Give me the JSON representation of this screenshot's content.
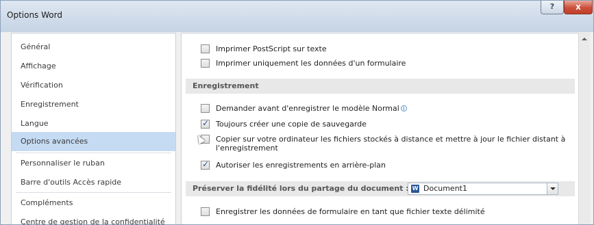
{
  "window": {
    "title": "Options Word",
    "help_symbol": "?",
    "close_symbol": "x"
  },
  "nav": {
    "items": [
      {
        "label": "Général",
        "selected": false
      },
      {
        "label": "Affichage",
        "selected": false
      },
      {
        "label": "Vérification",
        "selected": false
      },
      {
        "label": "Enregistrement",
        "selected": false
      },
      {
        "label": "Langue",
        "selected": false
      },
      {
        "label": "Options avancées",
        "selected": true
      },
      {
        "label": "Personnaliser le ruban",
        "selected": false
      },
      {
        "label": "Barre d'outils Accès rapide",
        "selected": false
      },
      {
        "label": "Compléments",
        "selected": false
      },
      {
        "label": "Centre de gestion de la confidentialité",
        "selected": false
      }
    ]
  },
  "content": {
    "top_options": [
      {
        "label": "Imprimer PostScript sur texte",
        "checked": false
      },
      {
        "label": "Imprimer uniquement les données d'un formulaire",
        "checked": false
      }
    ],
    "section_save": {
      "title": "Enregistrement",
      "options": [
        {
          "label": "Demander avant d'enregistrer le modèle Normal",
          "checked": false,
          "info_icon": "info-icon"
        },
        {
          "label": "Toujours créer une copie de sauvegarde",
          "checked": true
        },
        {
          "label": "Copier sur votre ordinateur les fichiers stockés à distance et mettre à jour le fichier distant à l'enregistrement",
          "checked": false
        },
        {
          "label": "Autoriser les enregistrements en arrière-plan",
          "checked": true
        }
      ]
    },
    "section_fidelity": {
      "title": "Préserver la fidélité lors du partage du document :",
      "document_value": "Document1",
      "document_icon_letter": "W",
      "options": [
        {
          "label": "Enregistrer les données de formulaire en tant que fichier texte délimité",
          "checked": false
        }
      ]
    }
  },
  "colors": {
    "selected_nav": "#c5dbf3",
    "section_band": "#e8e8e8",
    "check": "#2a4f8a",
    "close_button": "#c9503a"
  }
}
